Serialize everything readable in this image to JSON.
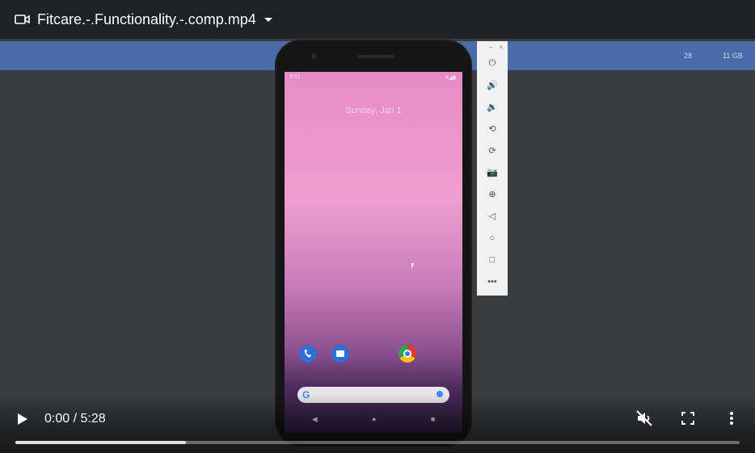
{
  "header": {
    "title": "Fitcare.-.Functionality.-.comp.mp4",
    "icon": "video-camera-icon"
  },
  "video_frame": {
    "strip_left_text": "28",
    "strip_right_text": "11 GB",
    "phone": {
      "status_time": "3:51",
      "status_icons": "▾◢▮",
      "date_text": "Sunday, Jan 1",
      "apps": [
        "phone-icon",
        "messages-icon",
        "chrome-icon"
      ],
      "search_g": "G",
      "nav": [
        "◀",
        "●",
        "■"
      ]
    },
    "emulator_toolbar": {
      "top_controls": [
        "–",
        "×"
      ],
      "buttons": [
        {
          "name": "power-icon",
          "glyph": "⏻"
        },
        {
          "name": "volume-up-icon",
          "glyph": "🔊"
        },
        {
          "name": "volume-down-icon",
          "glyph": "🔉"
        },
        {
          "name": "rotate-left-icon",
          "glyph": "⟲"
        },
        {
          "name": "rotate-right-icon",
          "glyph": "⟳"
        },
        {
          "name": "screenshot-icon",
          "glyph": "📷"
        },
        {
          "name": "zoom-icon",
          "glyph": "⊕"
        },
        {
          "name": "back-icon",
          "glyph": "◁"
        },
        {
          "name": "home-icon",
          "glyph": "○"
        },
        {
          "name": "overview-icon",
          "glyph": "□"
        },
        {
          "name": "more-icon",
          "glyph": "•••"
        }
      ]
    }
  },
  "controls": {
    "time": "0:00 / 5:28",
    "progress_fraction": 0.235,
    "icons": [
      "play-icon",
      "mute-icon",
      "fullscreen-icon",
      "more-vert-icon"
    ]
  }
}
